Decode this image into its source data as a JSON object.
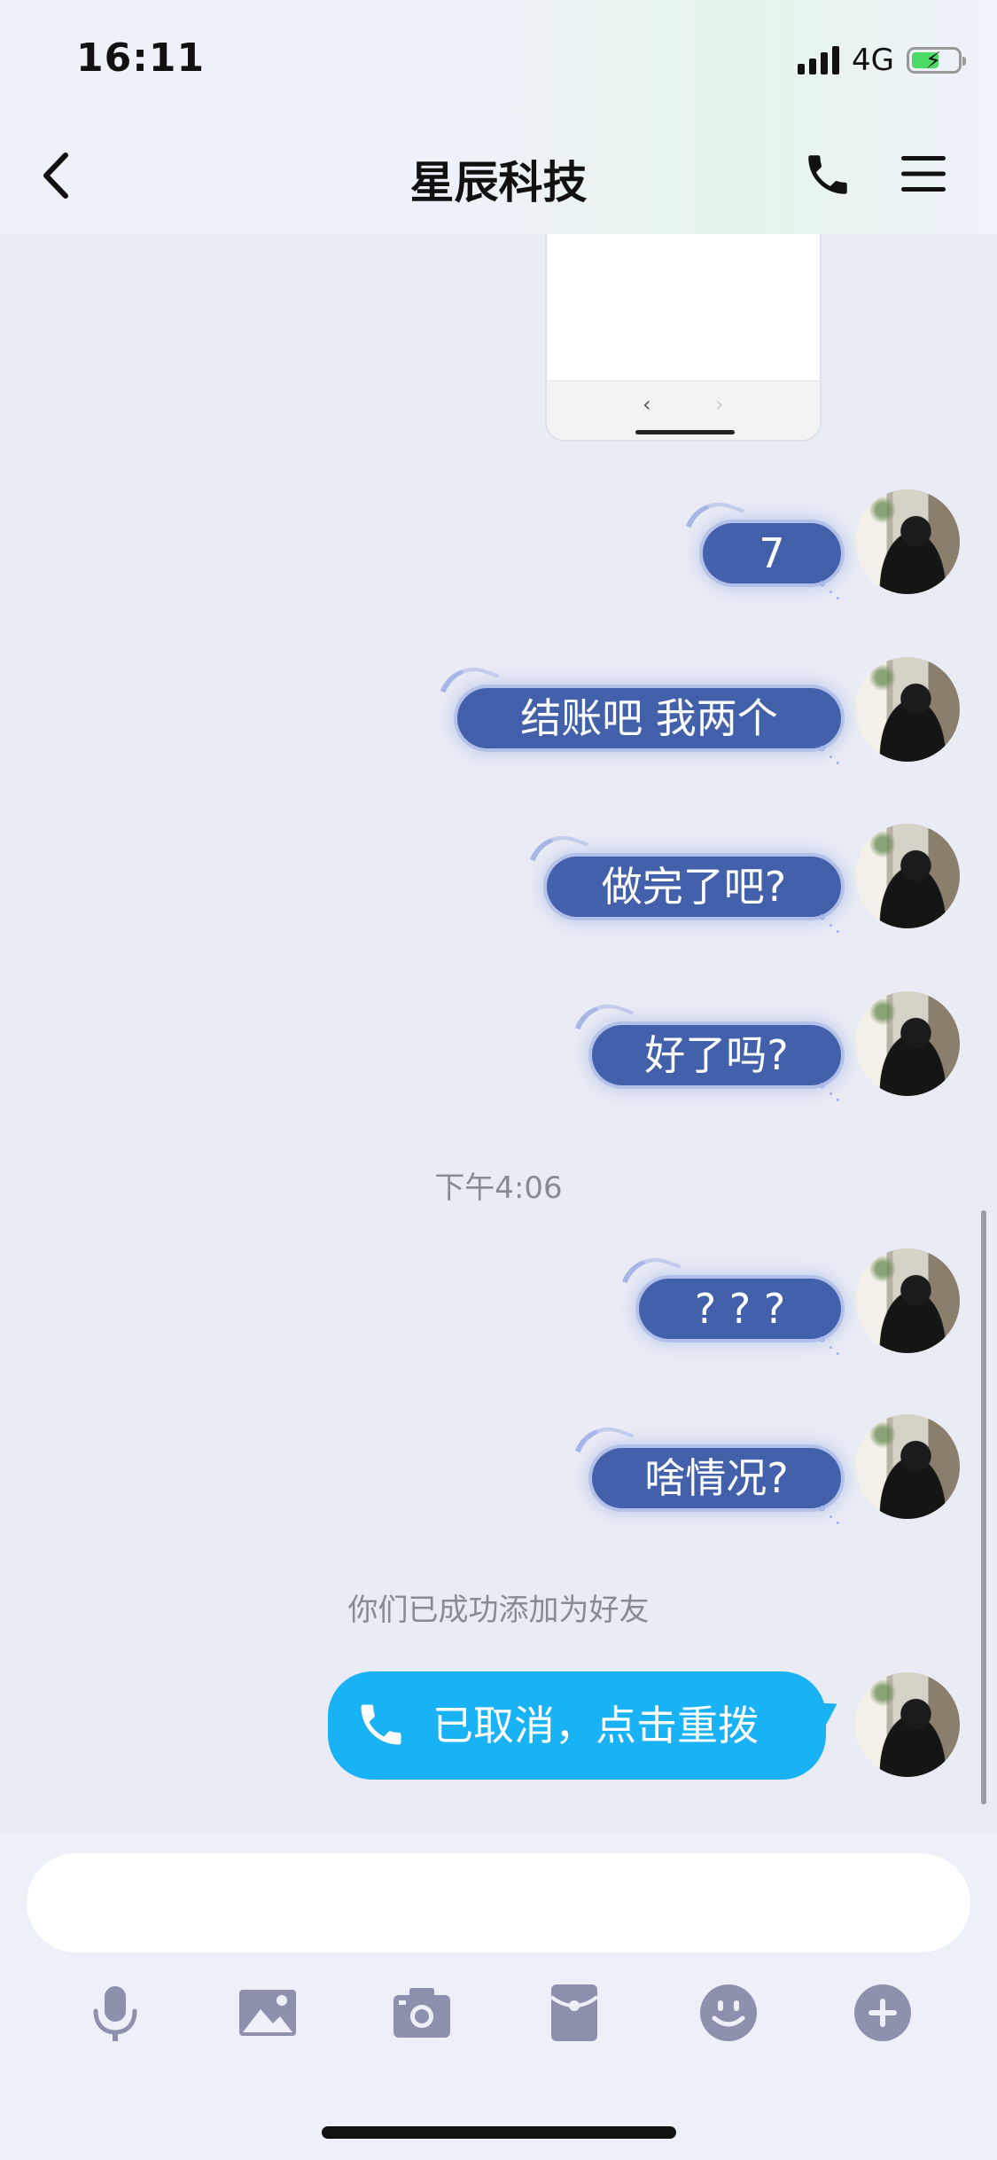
{
  "status_bar": {
    "time": "16:11",
    "network": "4G",
    "battery_charging": true,
    "battery_level": 0.6
  },
  "header": {
    "title": "星辰科技"
  },
  "messages": [
    {
      "type": "text",
      "text": "7"
    },
    {
      "type": "text",
      "text": "结账吧  我两个"
    },
    {
      "type": "text",
      "text": "做完了吧?"
    },
    {
      "type": "text",
      "text": "好了吗?"
    },
    {
      "type": "timestamp",
      "text": "下午4:06"
    },
    {
      "type": "text",
      "text": "? ? ?"
    },
    {
      "type": "text",
      "text": "啥情况?"
    },
    {
      "type": "system",
      "text": "你们已成功添加为好友"
    },
    {
      "type": "call",
      "text": "已取消，点击重拨"
    }
  ],
  "input": {
    "placeholder": ""
  },
  "toolbar": {
    "icons": [
      "microphone-icon",
      "image-icon",
      "camera-icon",
      "red-packet-icon",
      "emoji-icon",
      "plus-icon"
    ]
  },
  "colors": {
    "bubble": "#4361ab",
    "call_bubble": "#19b2f5",
    "background": "#e9ecf4",
    "toolbar_icon": "#8c91ad"
  }
}
